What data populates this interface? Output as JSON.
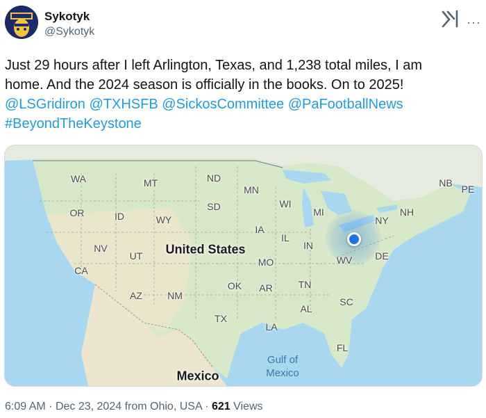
{
  "author": {
    "display_name": "Sykotyk",
    "handle": "@Sykotyk"
  },
  "tweet": {
    "line1": "Just 29 hours after I left Arlington, Texas, and 1,238 total miles, I am",
    "line2": "home. And the 2024 season is officially in the books. On to 2025!",
    "mentions": [
      "@LSGridiron",
      "@TXHSFB",
      "@SickosCommittee",
      "@PaFootballNews"
    ],
    "hashtag": "#BeyondTheKeystone"
  },
  "map": {
    "country_label": "United States",
    "mexico_label": "Mexico",
    "gulf_label_line1": "Gulf of",
    "gulf_label_line2": "Mexico",
    "states": [
      "WA",
      "MT",
      "ND",
      "MN",
      "NB",
      "PE",
      "OR",
      "ID",
      "WY",
      "SD",
      "WI",
      "MI",
      "NH",
      "NY",
      "IA",
      "IL",
      "IN",
      "NV",
      "UT",
      "DE",
      "MO",
      "WV",
      "CA",
      "OK",
      "AR",
      "TN",
      "AZ",
      "NM",
      "SC",
      "AL",
      "TX",
      "LA",
      "FL"
    ],
    "colors": {
      "land": "#d7e8c8",
      "water": "#a8d8f0",
      "canada": "#e6ebe0",
      "desert": "#ece4cc",
      "location": "#1a73e8"
    }
  },
  "meta": {
    "time": "6:09 AM",
    "separator": "·",
    "date": "Dec 23, 2024",
    "location": "from Ohio, USA",
    "views_count": "621",
    "views_label": "Views"
  },
  "colors": {
    "link": "#1d9bf0",
    "secondary_text": "#536471"
  }
}
